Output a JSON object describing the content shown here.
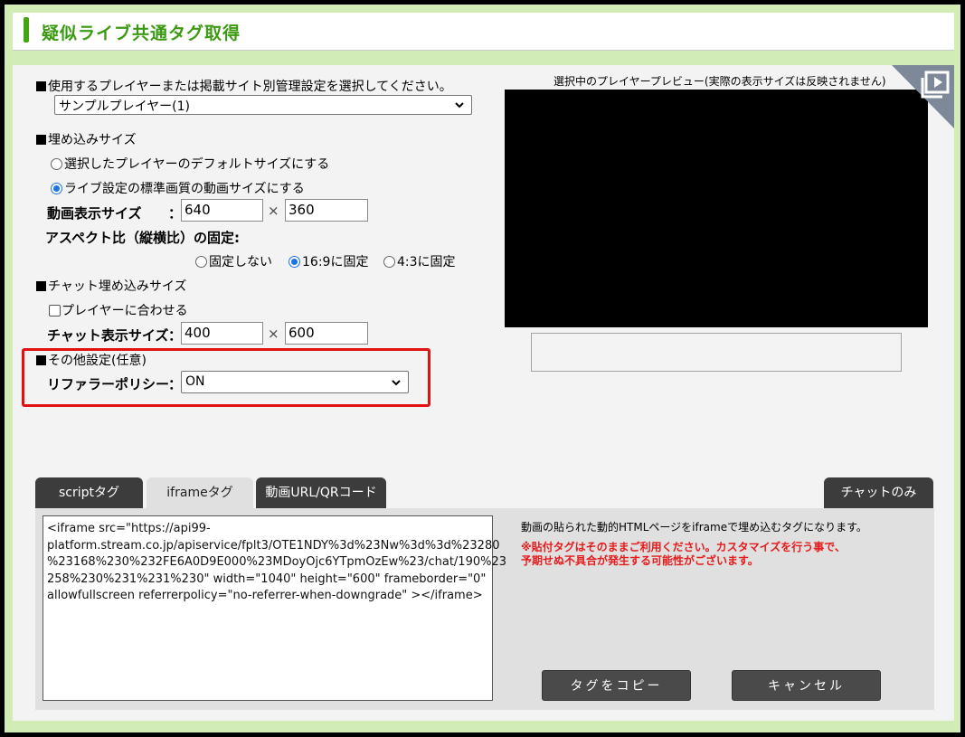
{
  "header": {
    "title": "疑似ライブ共通タグ取得"
  },
  "player": {
    "section_label": "使用するプレイヤーまたは掲載サイト別管理設定を選択してください。",
    "selected": "サンプルプレイヤー(1)"
  },
  "embed_size": {
    "section_label": "埋め込みサイズ",
    "option_default": "選択したプレイヤーのデフォルトサイズにする",
    "option_live": "ライブ設定の標準画質の動画サイズにする",
    "display_size_label": "動画表示サイズ",
    "colon": "：",
    "width": "640",
    "times": "×",
    "height": "360",
    "aspect_label": "アスペクト比（縦横比）の固定:",
    "aspect_none": "固定しない",
    "aspect_169": "16:9に固定",
    "aspect_43": "4:3に固定"
  },
  "chat": {
    "section_label": "チャット埋め込みサイズ",
    "fit_player": "プレイヤーに合わせる",
    "display_size_label": "チャット表示サイズ",
    "width": "400",
    "height": "600"
  },
  "other": {
    "section_label": "その他設定(任意)",
    "referrer_label": "リファラーポリシー",
    "referrer_value": "ON"
  },
  "preview": {
    "label": "選択中のプレイヤープレビュー(実際の表示サイズは反映されません)"
  },
  "tabs": {
    "script": "scriptタグ",
    "iframe": "iframeタグ",
    "url_qr": "動画URL/QRコード",
    "chat_only": "チャットのみ"
  },
  "code": {
    "lines": [
      "<iframe src=\"https://api99-",
      "platform.stream.co.jp/apiservice/fplt3/OTE1NDY%3d%23Nw%3d%3d%23280",
      "%23168%230%232FE6A0D9E000%23MDoyOjc6YTpmOzEw%23/chat/190%23",
      "258%230%231%231%230\" width=\"1040\" height=\"600\" frameborder=\"0\"",
      "allowfullscreen referrerpolicy=\"no-referrer-when-downgrade\" ></iframe>"
    ]
  },
  "info": {
    "description": "動画の貼られた動的HTMLページをiframeで埋め込むタグになります。",
    "warning_1": "※貼付タグはそのままご利用ください。カスタマイズを行う事で、",
    "warning_2": "予期せぬ不具合が発生する可能性がございます。"
  },
  "buttons": {
    "copy": "タグをコピー",
    "cancel": "キャンセル"
  },
  "colors": {
    "accent": "#3b9a12",
    "alert": "#e21010"
  }
}
